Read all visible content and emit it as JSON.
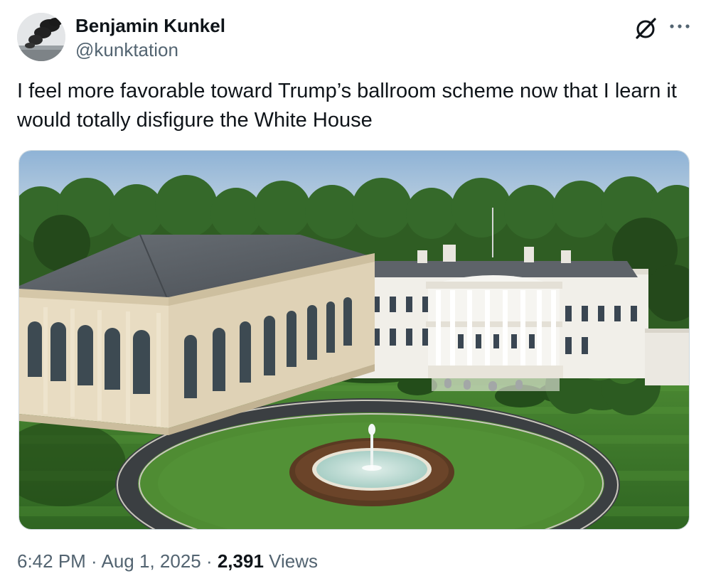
{
  "author": {
    "display_name": "Benjamin Kunkel",
    "handle": "@kunktation",
    "avatar_icon": "avatar-smoke-photo"
  },
  "header_actions": {
    "grok_icon": "grok-slash-icon",
    "more_icon": "more-horizontal-icon"
  },
  "tweet": {
    "text": "I feel more favorable toward Trump’s ballroom scheme now that I learn it would totally disfigure the White House"
  },
  "media": {
    "kind": "photo",
    "subject": "white-house-with-ballroom-render"
  },
  "meta": {
    "time": "6:42 PM",
    "sep1": " · ",
    "date": "Aug 1, 2025",
    "sep2": " · ",
    "views_count": "2,391",
    "views_label": " Views"
  },
  "colors": {
    "text_primary": "#0f1419",
    "text_secondary": "#536471",
    "border": "#cfd9de",
    "sky": "#a9c4dd",
    "lawn": "#3f7a2c",
    "building_white": "#f1efe9",
    "ballroom_cream": "#e8dcc2",
    "roof": "#5b6066"
  }
}
